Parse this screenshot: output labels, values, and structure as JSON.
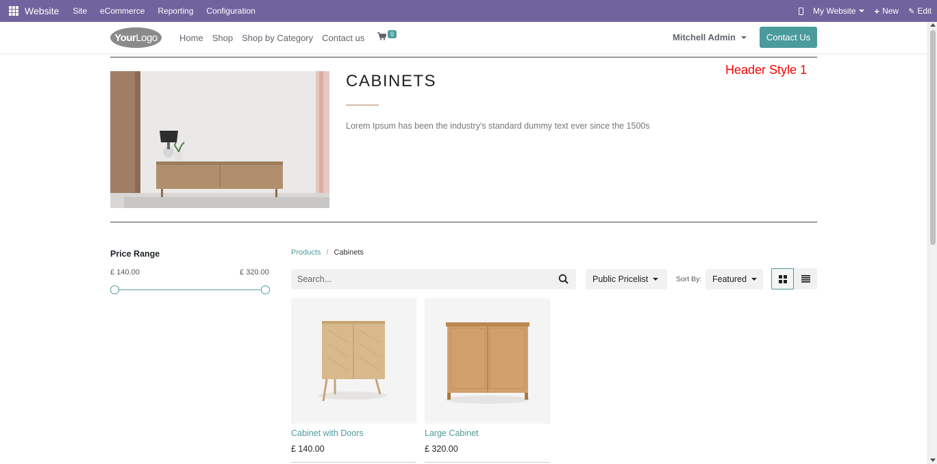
{
  "adminbar": {
    "brand": "Website",
    "menu": [
      "Site",
      "eCommerce",
      "Reporting",
      "Configuration"
    ],
    "my_website": "My Website",
    "new_label": "New",
    "edit_label": "Edit"
  },
  "header": {
    "logo_bold": "Your",
    "logo_light": "Logo",
    "nav": [
      "Home",
      "Shop",
      "Shop by Category",
      "Contact us"
    ],
    "cart_count": "0",
    "user": "Mitchell Admin",
    "contact_button": "Contact Us"
  },
  "category": {
    "title": "CABINETS",
    "description": "Lorem Ipsum has been the industry's standard dummy text ever since the 1500s",
    "annotation": "Header Style 1"
  },
  "price_range": {
    "title": "Price Range",
    "min": "£ 140.00",
    "max": "£ 320.00",
    "min_fraction": 0,
    "max_fraction": 1
  },
  "breadcrumb": {
    "parent": "Products",
    "separator": "/",
    "current": "Cabinets"
  },
  "toolbar": {
    "search_placeholder": "Search...",
    "pricelist": "Public Pricelist",
    "sort_label": "Sort By:",
    "sort_value": "Featured"
  },
  "products": [
    {
      "name": "Cabinet with Doors",
      "price": "£ 140.00"
    },
    {
      "name": "Large Cabinet",
      "price": "£ 320.00"
    }
  ],
  "colors": {
    "admin_bar": "#71639e",
    "accent": "#4c9b9c",
    "annotation": "#ff0000"
  },
  "icons": {
    "apps": "apps-grid-icon",
    "phone": "mobile-icon",
    "cart": "shopping-cart-icon",
    "search": "search-icon",
    "grid_view": "grid-view-icon",
    "list_view": "list-view-icon"
  }
}
